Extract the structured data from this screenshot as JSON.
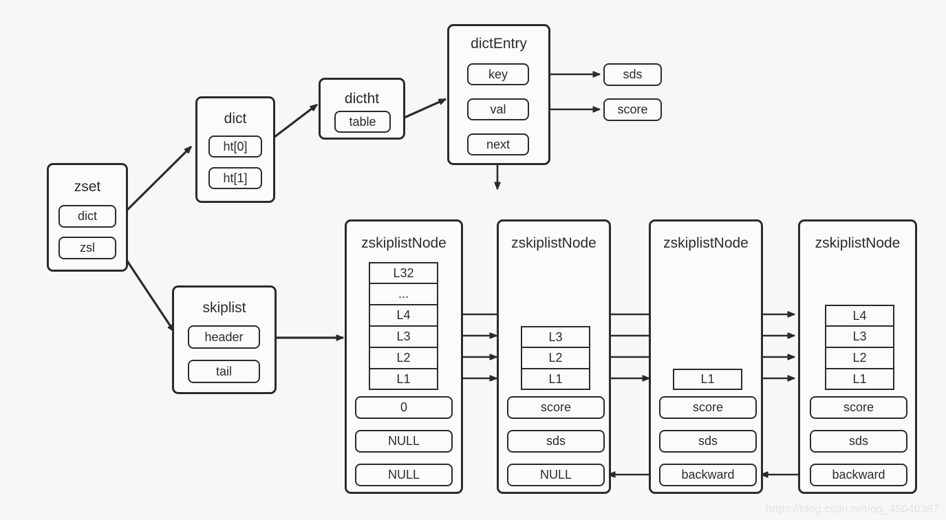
{
  "diagram": {
    "title": "Redis zset structure diagram",
    "background_color": "#f7f7f7",
    "stroke_color": "#2b2b2b",
    "watermark": "https://blog.csdn.net/qq_45040387"
  },
  "structs": {
    "zset": {
      "title": "zset",
      "fields": [
        {
          "label": "dict"
        },
        {
          "label": "zsl"
        }
      ]
    },
    "dict": {
      "title": "dict",
      "fields": [
        {
          "label": "ht[0]"
        },
        {
          "label": "ht[1]"
        }
      ]
    },
    "dictht": {
      "title": "dictht",
      "fields": [
        {
          "label": "table"
        }
      ]
    },
    "dictEntry": {
      "title": "dictEntry",
      "fields": [
        {
          "label": "key"
        },
        {
          "label": "val"
        },
        {
          "label": "next"
        }
      ]
    },
    "skiplist": {
      "title": "skiplist",
      "fields": [
        {
          "label": "header"
        },
        {
          "label": "tail"
        }
      ]
    }
  },
  "leaves": {
    "sds": "sds",
    "score": "score"
  },
  "skiplist_nodes": [
    {
      "title": "zskiplistNode",
      "levels": [
        "L32",
        "...",
        "L4",
        "L3",
        "L2",
        "L1"
      ],
      "fields": [
        "0",
        "NULL",
        "NULL"
      ]
    },
    {
      "title": "zskiplistNode",
      "levels": [
        "L3",
        "L2",
        "L1"
      ],
      "fields": [
        "score",
        "sds",
        "NULL"
      ]
    },
    {
      "title": "zskiplistNode",
      "levels": [
        "L1"
      ],
      "fields": [
        "score",
        "sds",
        "backward"
      ]
    },
    {
      "title": "zskiplistNode",
      "levels": [
        "L4",
        "L3",
        "L2",
        "L1"
      ],
      "fields": [
        "score",
        "sds",
        "backward"
      ]
    }
  ]
}
